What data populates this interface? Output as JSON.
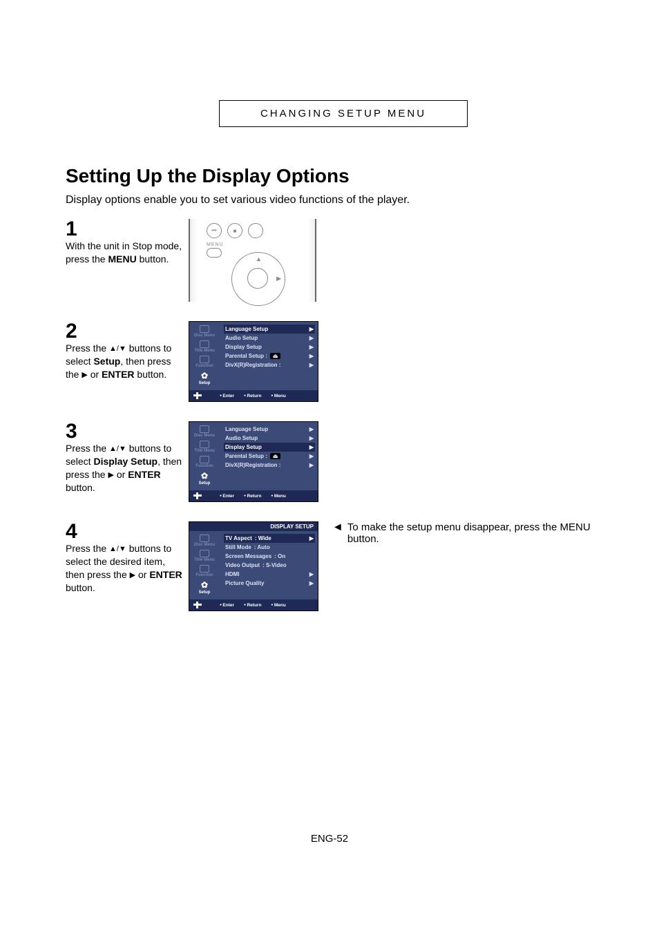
{
  "header": "CHANGING SETUP MENU",
  "title": "Setting Up the Display Options",
  "intro": "Display options enable you to set various video functions of the player.",
  "symbols": {
    "up": "▲",
    "down": "▼",
    "right": "▶",
    "slash": "/",
    "noteArrow": "◄"
  },
  "steps": {
    "s1": {
      "num": "1",
      "pre": "With the unit in Stop mode, press the ",
      "bold": "MENU",
      "post": " button."
    },
    "s2": {
      "num": "2",
      "t1": "Press the ",
      "t2": " buttons to select ",
      "bold1": "Setup",
      "t3": ", then press the ",
      "t4": " or ",
      "bold2": "ENTER",
      "t5": " button."
    },
    "s3": {
      "num": "3",
      "t1": "Press the ",
      "t2": " buttons to select ",
      "bold1": "Display Setup",
      "t3": ", then press the ",
      "t4": " or ",
      "bold2": "ENTER",
      "t5": " button."
    },
    "s4": {
      "num": "4",
      "t1": "Press the ",
      "t2": " buttons to select the desired item, then press the ",
      "t4": " or ",
      "bold2": "ENTER",
      "t5": " button."
    }
  },
  "note": "To make the setup menu disappear, press the MENU button.",
  "remote": {
    "menuLabel": "MENU",
    "prev": "⏮",
    "stop": "■"
  },
  "osd": {
    "sidebar": {
      "disc": "Disc Menu",
      "title": "Title Menu",
      "func": "Function",
      "setup": "Setup"
    },
    "setupList": {
      "lang": "Language Setup",
      "audio": "Audio Setup",
      "display": "Display Setup",
      "parental": "Parental Setup :",
      "divx": "DivX(R)Registration :"
    },
    "displayTitle": "DISPLAY SETUP",
    "displayList": {
      "tvAspect": "TV Aspect",
      "tvAspectVal": ": Wide",
      "still": "Still Mode",
      "stillVal": ": Auto",
      "screen": "Screen Messages",
      "screenVal": ": On",
      "video": "Video Output",
      "videoVal": ": S-Video",
      "hdmi": "HDMI",
      "pic": "Picture Quality"
    },
    "footer": {
      "enter": "Enter",
      "return": "Return",
      "menu": "Menu"
    }
  },
  "pageNumber": "ENG-52"
}
